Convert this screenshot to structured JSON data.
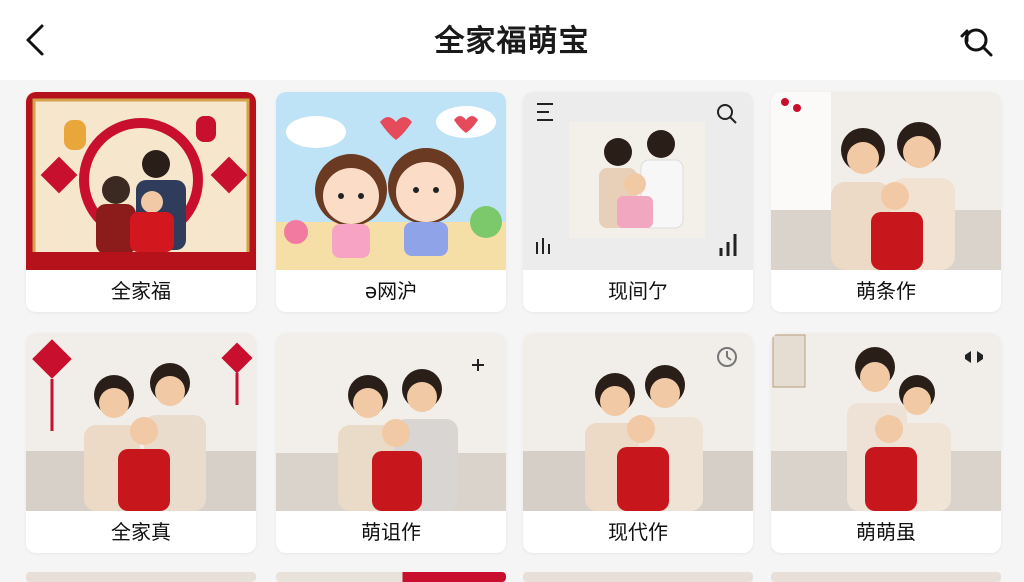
{
  "header": {
    "title": "全家福萌宝",
    "back_icon": "back-arrow-icon",
    "search_icon": "search-icon"
  },
  "colors": {
    "accent_red": "#c8102e",
    "gold": "#e2b04a",
    "background": "#f5f5f5"
  },
  "cards": [
    {
      "label": "全家福"
    },
    {
      "label": "ə网沪"
    },
    {
      "label": "现间亇"
    },
    {
      "label": "萌条作"
    },
    {
      "label": "全家真"
    },
    {
      "label": "萌诅作"
    },
    {
      "label": "现代作"
    },
    {
      "label": "萌萌虽"
    }
  ]
}
